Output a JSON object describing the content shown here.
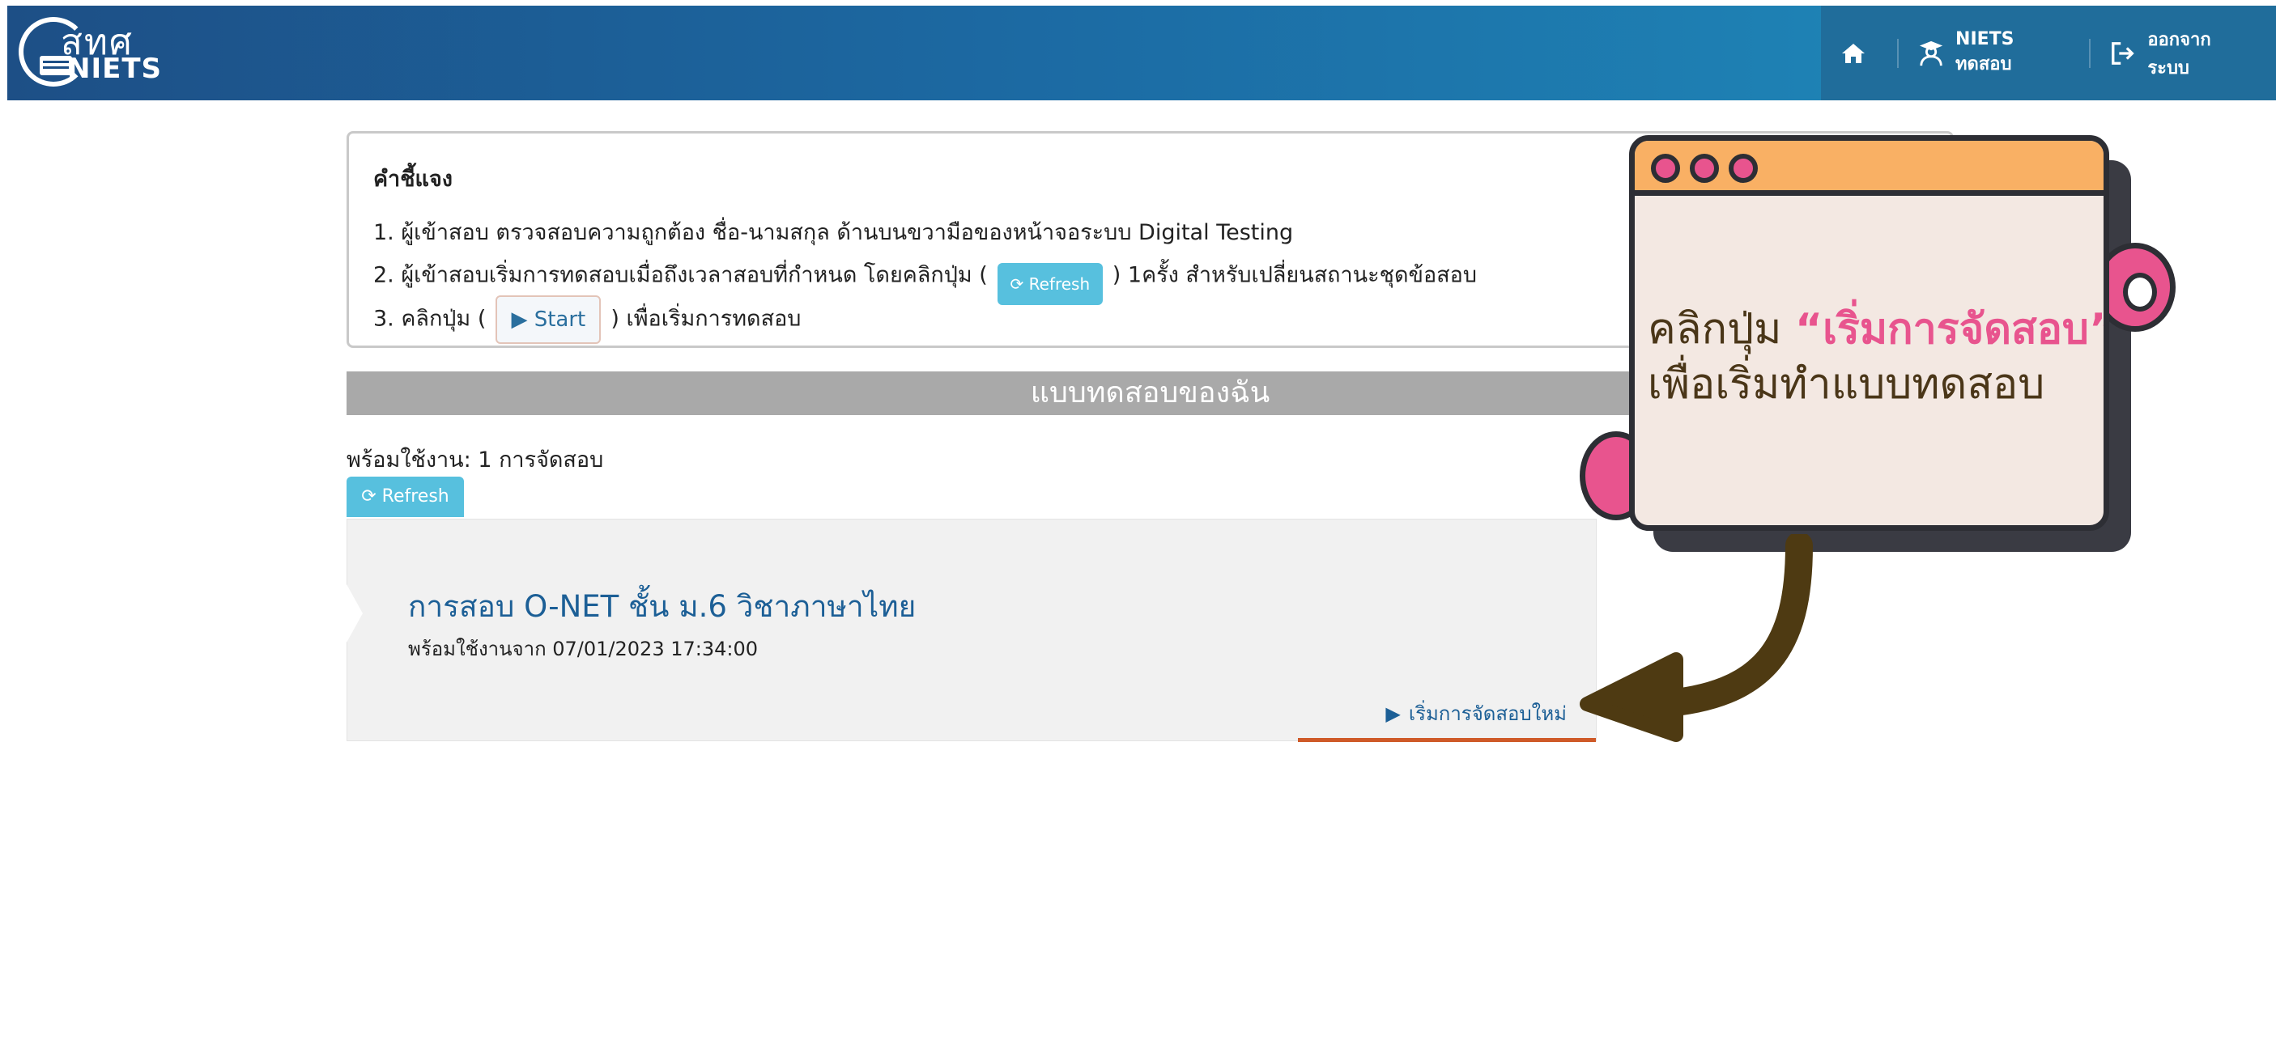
{
  "header": {
    "logo_thai": "สทศ",
    "logo_en": "NIETS",
    "nav": [
      {
        "label": "",
        "icon": "home-icon"
      },
      {
        "label": "NIETS ทดสอบ",
        "icon": "user-graduate-icon"
      },
      {
        "label": "ออกจากระบบ",
        "icon": "sign-out-icon"
      }
    ]
  },
  "instructions": {
    "title": "คำชี้แจง",
    "line1": "1. ผู้เข้าสอบ ตรวจสอบความถูกต้อง ชื่อ-นามสกุล ด้านบนขวามือของหน้าจอระบบ Digital Testing",
    "line2_before": "2. ผู้เข้าสอบเริ่มการทดสอบเมื่อถึงเวลาสอบที่กำหนด โดยคลิกปุ่ม (",
    "line2_button": "Refresh",
    "line2_after": ") 1ครั้ง สำหรับเปลี่ยนสถานะชุดข้อสอบ",
    "line3_before": "3. คลิกปุ่ม (",
    "line3_button": "Start",
    "line3_after": ") เพื่อเริ่มการทดสอบ"
  },
  "section_title": "แบบทดสอบของฉัน",
  "ready_text": "พร้อมใช้งาน: 1 การจัดสอบ",
  "refresh_label": "Refresh",
  "exam": {
    "title": "การสอบ O-NET ชั้น ม.6 วิชาภาษาไทย",
    "available_from": "พร้อมใช้งานจาก 07/01/2023 17:34:00",
    "start_label": "เริ่มการจัดสอบใหม่"
  },
  "annotation": {
    "prefix": "คลิกปุ่ม ",
    "highlight": "“เริ่มการจัดสอบ”",
    "line2": "เพื่อเริ่มทำแบบทดสอบ"
  },
  "colors": {
    "header_start": "#1d4f86",
    "header_end": "#1f8fbe",
    "accent_pink": "#e8548e",
    "annotation_orange": "#f9b064",
    "arrow_brown": "#4e3a12",
    "link_blue": "#1c5f96",
    "refresh_cyan": "#57c0de",
    "underline_orange": "#cf5a28"
  }
}
